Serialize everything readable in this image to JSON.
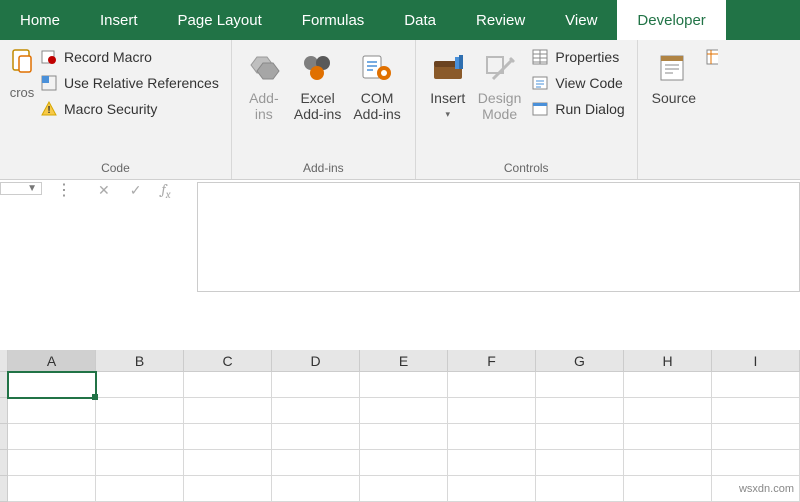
{
  "tabs": [
    "Home",
    "Insert",
    "Page Layout",
    "Formulas",
    "Data",
    "Review",
    "View",
    "Developer"
  ],
  "activeTab": "Developer",
  "ribbon": {
    "code": {
      "label": "Code",
      "macros_frag": "cros",
      "record": "Record Macro",
      "relative": "Use Relative References",
      "security": "Macro Security"
    },
    "addins": {
      "label": "Add-ins",
      "addins1_l1": "Add-",
      "addins1_l2": "ins",
      "excel_l1": "Excel",
      "excel_l2": "Add-ins",
      "com_l1": "COM",
      "com_l2": "Add-ins"
    },
    "controls": {
      "label": "Controls",
      "insert": "Insert",
      "design_l1": "Design",
      "design_l2": "Mode",
      "properties": "Properties",
      "viewcode": "View Code",
      "rundialog": "Run Dialog"
    },
    "xml": {
      "source": "Source"
    }
  },
  "columns": [
    "A",
    "B",
    "C",
    "D",
    "E",
    "F",
    "G",
    "H",
    "I"
  ],
  "selectedColumn": "A",
  "watermark": "wsxdn.com"
}
